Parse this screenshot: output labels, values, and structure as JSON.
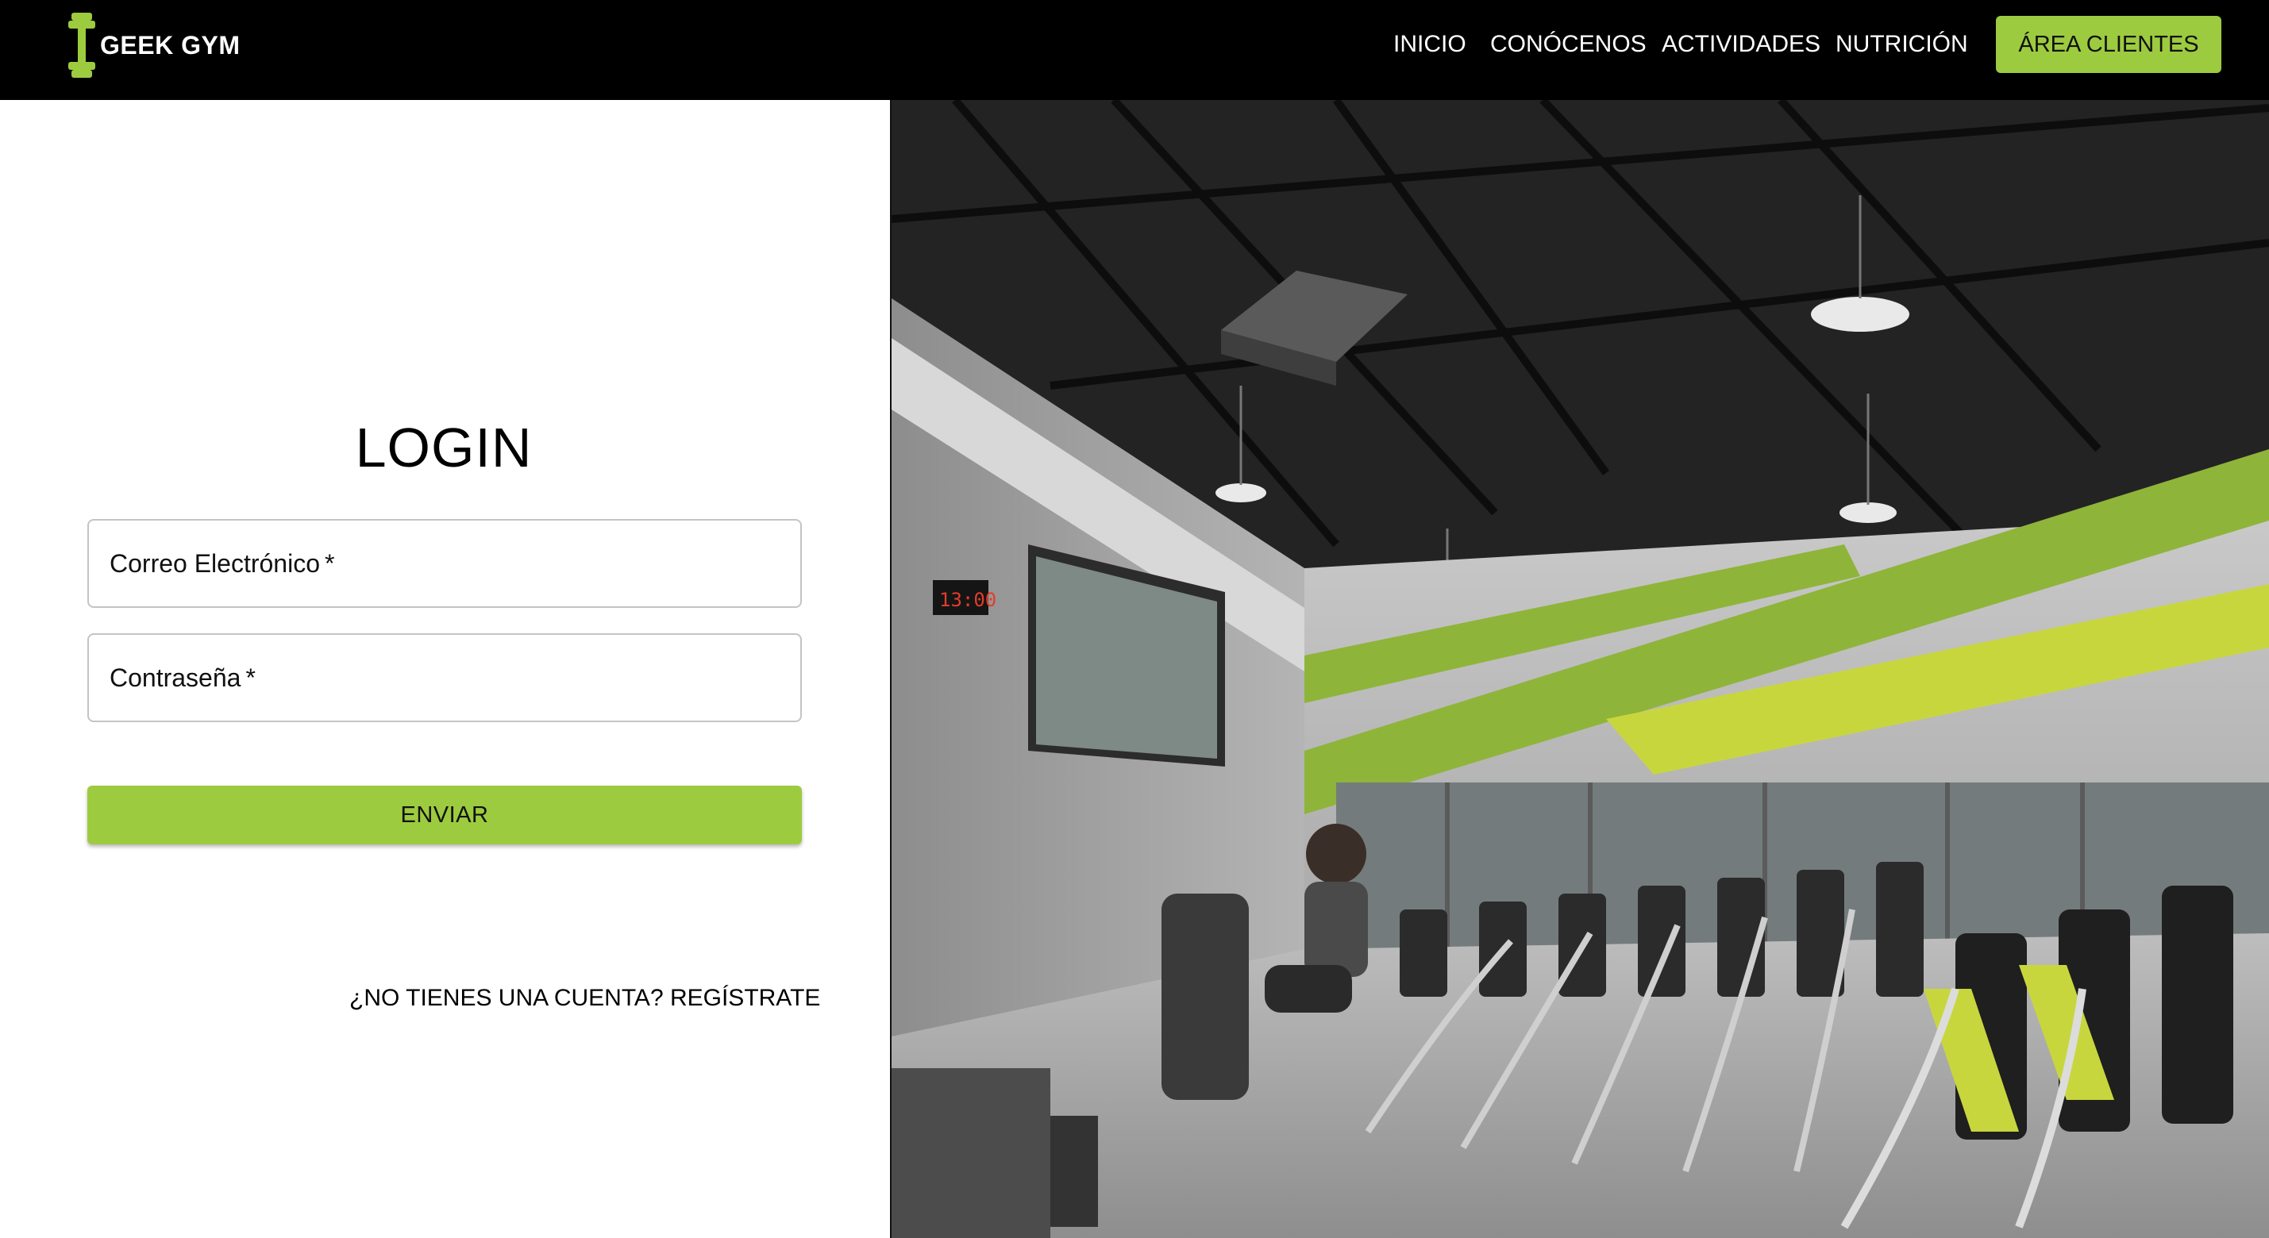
{
  "brand": {
    "name": "GEEK GYM",
    "icon": "dumbbell-icon",
    "accent_color": "#9dcb3f"
  },
  "nav": {
    "links": [
      {
        "label": "INICIO"
      },
      {
        "label": "CONÓCENOS"
      },
      {
        "label": "ACTIVIDADES"
      },
      {
        "label": "NUTRICIÓN"
      }
    ],
    "client_area_label": "ÁREA CLIENTES"
  },
  "login": {
    "title": "LOGIN",
    "email": {
      "label": "Correo Electrónico",
      "required_mark": "*",
      "value": ""
    },
    "password": {
      "label": "Contraseña",
      "required_mark": "*",
      "value": ""
    },
    "submit_label": "ENVIAR",
    "register_link": "¿NO TIENES UNA CUENTA? REGÍSTRATE"
  },
  "hero_image": {
    "subject": "gym-interior-photo",
    "clock_text": "13:00"
  }
}
